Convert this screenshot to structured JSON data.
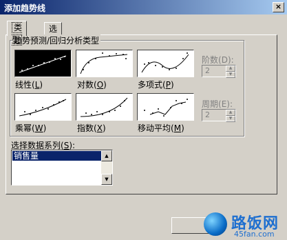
{
  "window": {
    "title": "添加趋势线",
    "close_glyph": "×"
  },
  "tabs": [
    {
      "label": "类型",
      "active": true
    },
    {
      "label": "选项",
      "active": false
    }
  ],
  "group": {
    "label": "趋势预测/回归分析类型"
  },
  "types": [
    {
      "label": "线性",
      "key": "L",
      "selected": true,
      "icon": "linear-chart-icon"
    },
    {
      "label": "对数",
      "key": "O",
      "selected": false,
      "icon": "log-chart-icon"
    },
    {
      "label": "多项式",
      "key": "P",
      "selected": false,
      "icon": "polynomial-chart-icon"
    },
    {
      "label": "乘幂",
      "key": "W",
      "selected": false,
      "icon": "power-chart-icon"
    },
    {
      "label": "指数",
      "key": "X",
      "selected": false,
      "icon": "exponential-chart-icon"
    },
    {
      "label": "移动平均",
      "key": "M",
      "selected": false,
      "icon": "moving-average-chart-icon"
    }
  ],
  "order": {
    "label": "阶数",
    "key": "D",
    "value": "2"
  },
  "period": {
    "label": "周期",
    "key": "E",
    "value": "2"
  },
  "series": {
    "label": "选择数据系列",
    "key": "S",
    "items": [
      "销售量"
    ]
  },
  "watermark": {
    "text": "路饭网",
    "url": "45fan.com"
  },
  "colors": {
    "titlebar": "#0a246a",
    "selection": "#0a246a",
    "face": "#d4d0c8"
  }
}
